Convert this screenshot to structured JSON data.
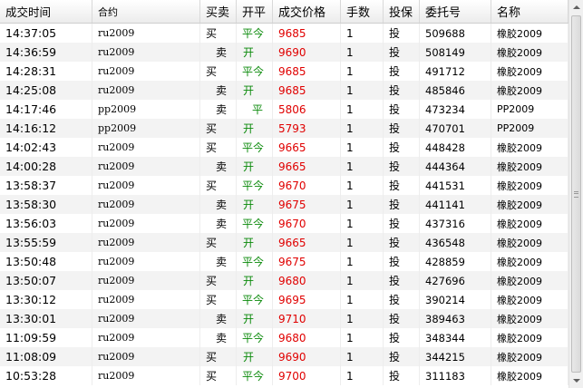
{
  "headers": {
    "time": "成交时间",
    "code": "合约",
    "side": "买卖",
    "oc": "开平",
    "price": "成交价格",
    "qty": "手数",
    "hedge": "投保",
    "order": "委托号",
    "name": "名称"
  },
  "colors": {
    "price": "#e00000",
    "open_close": "#0b8a0b"
  },
  "rows": [
    {
      "time": "14:37:05",
      "code": "ru2009",
      "side": "买",
      "oc": "平今",
      "price": "9685",
      "qty": "1",
      "hedge": "投",
      "order": "509688",
      "name": "橡胶2009"
    },
    {
      "time": "14:36:59",
      "code": "ru2009",
      "side": "卖",
      "oc": "开",
      "price": "9690",
      "qty": "1",
      "hedge": "投",
      "order": "508149",
      "name": "橡胶2009"
    },
    {
      "time": "14:28:31",
      "code": "ru2009",
      "side": "买",
      "oc": "平今",
      "price": "9685",
      "qty": "1",
      "hedge": "投",
      "order": "491712",
      "name": "橡胶2009"
    },
    {
      "time": "14:25:08",
      "code": "ru2009",
      "side": "卖",
      "oc": "开",
      "price": "9685",
      "qty": "1",
      "hedge": "投",
      "order": "485846",
      "name": "橡胶2009"
    },
    {
      "time": "14:17:46",
      "code": "pp2009",
      "side": "卖",
      "oc": "平",
      "price": "5806",
      "qty": "1",
      "hedge": "投",
      "order": "473234",
      "name": "PP2009"
    },
    {
      "time": "14:16:12",
      "code": "pp2009",
      "side": "买",
      "oc": "开",
      "price": "5793",
      "qty": "1",
      "hedge": "投",
      "order": "470701",
      "name": "PP2009"
    },
    {
      "time": "14:02:43",
      "code": "ru2009",
      "side": "买",
      "oc": "平今",
      "price": "9665",
      "qty": "1",
      "hedge": "投",
      "order": "448428",
      "name": "橡胶2009"
    },
    {
      "time": "14:00:28",
      "code": "ru2009",
      "side": "卖",
      "oc": "开",
      "price": "9665",
      "qty": "1",
      "hedge": "投",
      "order": "444364",
      "name": "橡胶2009"
    },
    {
      "time": "13:58:37",
      "code": "ru2009",
      "side": "买",
      "oc": "平今",
      "price": "9670",
      "qty": "1",
      "hedge": "投",
      "order": "441531",
      "name": "橡胶2009"
    },
    {
      "time": "13:58:30",
      "code": "ru2009",
      "side": "卖",
      "oc": "开",
      "price": "9675",
      "qty": "1",
      "hedge": "投",
      "order": "441141",
      "name": "橡胶2009"
    },
    {
      "time": "13:56:03",
      "code": "ru2009",
      "side": "卖",
      "oc": "平今",
      "price": "9670",
      "qty": "1",
      "hedge": "投",
      "order": "437316",
      "name": "橡胶2009"
    },
    {
      "time": "13:55:59",
      "code": "ru2009",
      "side": "买",
      "oc": "开",
      "price": "9665",
      "qty": "1",
      "hedge": "投",
      "order": "436548",
      "name": "橡胶2009"
    },
    {
      "time": "13:50:48",
      "code": "ru2009",
      "side": "卖",
      "oc": "平今",
      "price": "9675",
      "qty": "1",
      "hedge": "投",
      "order": "428859",
      "name": "橡胶2009"
    },
    {
      "time": "13:50:07",
      "code": "ru2009",
      "side": "买",
      "oc": "开",
      "price": "9680",
      "qty": "1",
      "hedge": "投",
      "order": "427696",
      "name": "橡胶2009"
    },
    {
      "time": "13:30:12",
      "code": "ru2009",
      "side": "买",
      "oc": "平今",
      "price": "9695",
      "qty": "1",
      "hedge": "投",
      "order": "390214",
      "name": "橡胶2009"
    },
    {
      "time": "13:30:01",
      "code": "ru2009",
      "side": "卖",
      "oc": "开",
      "price": "9710",
      "qty": "1",
      "hedge": "投",
      "order": "389463",
      "name": "橡胶2009"
    },
    {
      "time": "11:09:59",
      "code": "ru2009",
      "side": "卖",
      "oc": "平今",
      "price": "9680",
      "qty": "1",
      "hedge": "投",
      "order": "348344",
      "name": "橡胶2009"
    },
    {
      "time": "11:08:09",
      "code": "ru2009",
      "side": "买",
      "oc": "开",
      "price": "9690",
      "qty": "1",
      "hedge": "投",
      "order": "344215",
      "name": "橡胶2009"
    },
    {
      "time": "10:53:28",
      "code": "ru2009",
      "side": "买",
      "oc": "平今",
      "price": "9700",
      "qty": "1",
      "hedge": "投",
      "order": "311183",
      "name": "橡胶2009"
    }
  ],
  "scrollbar": {
    "up_icon": "triangle-up-icon",
    "down_icon": "triangle-down-icon",
    "grip_icon": "grip-lines-icon"
  }
}
